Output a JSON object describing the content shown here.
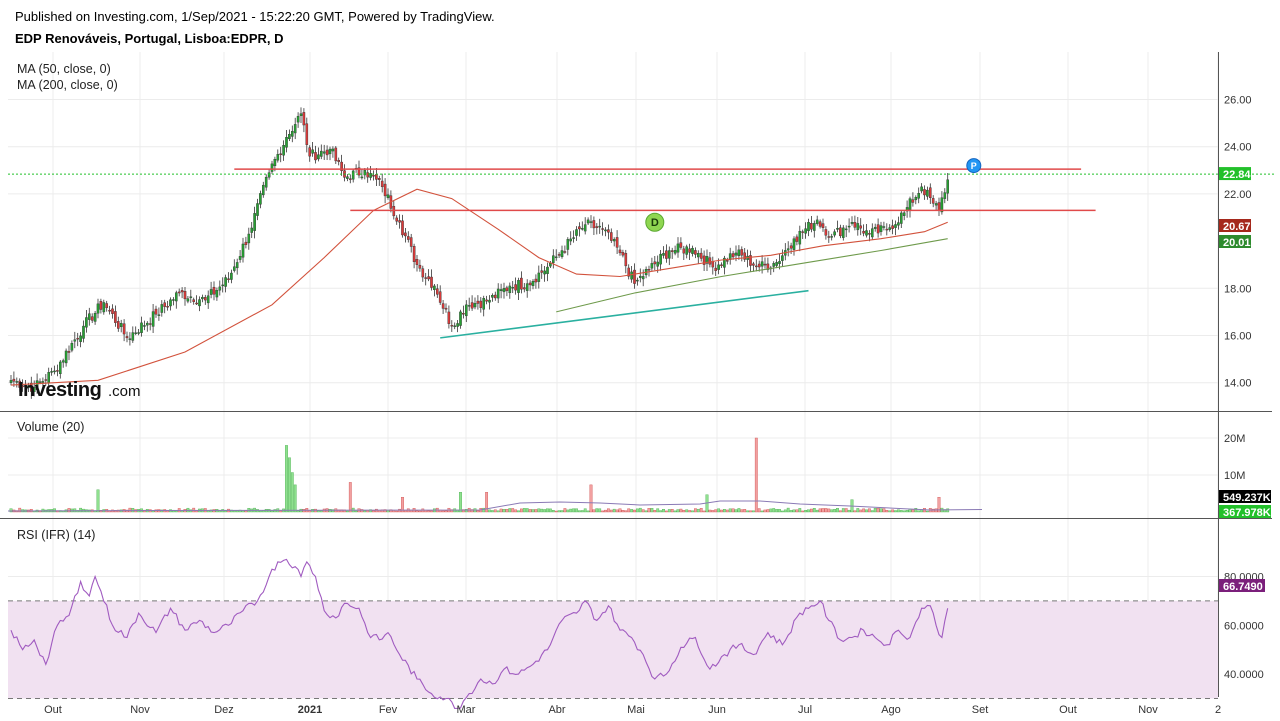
{
  "header": {
    "published": "Published on Investing.com, 1/Sep/2021 - 15:22:20 GMT, Powered by TradingView.",
    "instrument": "EDP Renováveis, Portugal, Lisboa:EDPR, D"
  },
  "watermark": "Investing.com",
  "colors": {
    "up": "#26a032",
    "down": "#d83a3a",
    "ma50": "#d2523c",
    "ma200": "#6e9a4b",
    "hline": "#e04a4a",
    "trend": "#2ab0a0",
    "rsi": "#a05bc0",
    "rsi_band": "#f1e1f1",
    "last_price": "#22c02a",
    "ma50_tag": "#a5281c",
    "ma200_tag": "#2e8b2e",
    "vol_tag1": "#000000",
    "vol_tag2": "#22c02a",
    "rsi_tag": "#7b1f7b"
  },
  "chart_data": [
    {
      "type": "candlestick",
      "title": "EDP Renováveis, Portugal, Lisboa:EDPR, D",
      "indicators": [
        "MA (50, close, 0)",
        "MA (200, close, 0)"
      ],
      "x_ticks": [
        "Out",
        "Nov",
        "Dez",
        "2021",
        "Fev",
        "Mar",
        "Abr",
        "Mai",
        "Jun",
        "Jul",
        "Ago",
        "Set",
        "Out",
        "Nov",
        "2"
      ],
      "y_ticks": [
        "26.00",
        "24.00",
        "22.00",
        "18.00",
        "16.00",
        "14.00"
      ],
      "ylim": [
        13.0,
        27.0
      ],
      "anchor_closes": [
        [
          0,
          14.1
        ],
        [
          8,
          13.8
        ],
        [
          15,
          14.5
        ],
        [
          25,
          16.4
        ],
        [
          32,
          17.4
        ],
        [
          40,
          15.9
        ],
        [
          50,
          16.9
        ],
        [
          58,
          17.8
        ],
        [
          67,
          17.5
        ],
        [
          75,
          18.4
        ],
        [
          82,
          20.3
        ],
        [
          89,
          22.9
        ],
        [
          95,
          24.4
        ],
        [
          100,
          25.4
        ],
        [
          103,
          23.6
        ],
        [
          110,
          23.9
        ],
        [
          115,
          22.7
        ],
        [
          122,
          23.0
        ],
        [
          128,
          22.3
        ],
        [
          134,
          20.8
        ],
        [
          140,
          19.0
        ],
        [
          146,
          18.1
        ],
        [
          152,
          16.4
        ],
        [
          157,
          17.3
        ],
        [
          165,
          17.5
        ],
        [
          172,
          18.1
        ],
        [
          178,
          18.2
        ],
        [
          185,
          18.9
        ],
        [
          190,
          19.6
        ],
        [
          198,
          20.7
        ],
        [
          204,
          20.5
        ],
        [
          210,
          19.5
        ],
        [
          215,
          18.2
        ],
        [
          220,
          18.8
        ],
        [
          227,
          19.6
        ],
        [
          235,
          19.7
        ],
        [
          242,
          18.9
        ],
        [
          250,
          19.5
        ],
        [
          258,
          18.9
        ],
        [
          264,
          19.1
        ],
        [
          270,
          20.1
        ],
        [
          278,
          20.9
        ],
        [
          283,
          20.2
        ],
        [
          290,
          20.8
        ],
        [
          296,
          20.3
        ],
        [
          302,
          20.5
        ],
        [
          308,
          21.2
        ],
        [
          314,
          22.3
        ],
        [
          318,
          21.6
        ],
        [
          320,
          21.3
        ],
        [
          323,
          22.6
        ]
      ],
      "ma50": [
        [
          0,
          13.9
        ],
        [
          30,
          14.1
        ],
        [
          60,
          15.3
        ],
        [
          90,
          17.3
        ],
        [
          108,
          19.3
        ],
        [
          125,
          21.3
        ],
        [
          140,
          22.2
        ],
        [
          152,
          21.8
        ],
        [
          168,
          20.5
        ],
        [
          182,
          19.3
        ],
        [
          195,
          18.6
        ],
        [
          210,
          18.5
        ],
        [
          230,
          18.9
        ],
        [
          245,
          19.2
        ],
        [
          262,
          19.4
        ],
        [
          280,
          19.8
        ],
        [
          300,
          20.1
        ],
        [
          315,
          20.4
        ],
        [
          323,
          20.8
        ]
      ],
      "ma200": [
        [
          188,
          17.0
        ],
        [
          215,
          17.8
        ],
        [
          245,
          18.5
        ],
        [
          275,
          19.1
        ],
        [
          300,
          19.6
        ],
        [
          323,
          20.1
        ]
      ],
      "hlines": [
        {
          "x0": 77,
          "x1": 369,
          "y": 23.05
        },
        {
          "x0": 117,
          "x1": 374,
          "y": 21.3
        }
      ],
      "trendline": {
        "x0": 148,
        "y0": 15.9,
        "x1": 275,
        "y1": 17.9
      },
      "markers": [
        {
          "label": "D",
          "x": 222,
          "y": 20.8
        },
        {
          "label": "P",
          "x": 332,
          "y": 23.2
        }
      ],
      "last_values": {
        "price": "22.84",
        "ma50": "20.67",
        "ma200": "20.01"
      }
    },
    {
      "type": "bar",
      "title": "Volume (20)",
      "y_ticks": [
        "20M",
        "10M"
      ],
      "last_values": {
        "volume": "549.237K",
        "volume_ma": "367.978K"
      },
      "spikes": [
        [
          30,
          9
        ],
        [
          95,
          27
        ],
        [
          96,
          22
        ],
        [
          97,
          16
        ],
        [
          98,
          11
        ],
        [
          117,
          12
        ],
        [
          135,
          6
        ],
        [
          155,
          8
        ],
        [
          164,
          8
        ],
        [
          200,
          11
        ],
        [
          240,
          7
        ],
        [
          257,
          30
        ],
        [
          290,
          5
        ],
        [
          320,
          6
        ]
      ]
    },
    {
      "type": "line",
      "title": "RSI (IFR) (14)",
      "y_ticks": [
        "80.0000",
        "60.0000",
        "40.0000"
      ],
      "ylim": [
        27,
        88
      ],
      "bands": [
        30,
        70
      ],
      "last_value": "66.7490",
      "values": [
        [
          0,
          58
        ],
        [
          4,
          50
        ],
        [
          8,
          54
        ],
        [
          12,
          44
        ],
        [
          16,
          60
        ],
        [
          20,
          64
        ],
        [
          24,
          78
        ],
        [
          27,
          72
        ],
        [
          29,
          80
        ],
        [
          31,
          74
        ],
        [
          35,
          60
        ],
        [
          40,
          55
        ],
        [
          44,
          65
        ],
        [
          50,
          57
        ],
        [
          55,
          67
        ],
        [
          60,
          58
        ],
        [
          65,
          62
        ],
        [
          70,
          57
        ],
        [
          75,
          60
        ],
        [
          80,
          66
        ],
        [
          85,
          70
        ],
        [
          89,
          80
        ],
        [
          92,
          86
        ],
        [
          95,
          87
        ],
        [
          98,
          84
        ],
        [
          100,
          80
        ],
        [
          102,
          86
        ],
        [
          105,
          80
        ],
        [
          108,
          66
        ],
        [
          112,
          63
        ],
        [
          115,
          69
        ],
        [
          120,
          67
        ],
        [
          123,
          57
        ],
        [
          127,
          54
        ],
        [
          130,
          57
        ],
        [
          134,
          48
        ],
        [
          140,
          38
        ],
        [
          145,
          32
        ],
        [
          150,
          30
        ],
        [
          154,
          26
        ],
        [
          158,
          32
        ],
        [
          162,
          38
        ],
        [
          166,
          36
        ],
        [
          170,
          42
        ],
        [
          175,
          40
        ],
        [
          180,
          44
        ],
        [
          185,
          50
        ],
        [
          190,
          62
        ],
        [
          195,
          65
        ],
        [
          198,
          70
        ],
        [
          202,
          62
        ],
        [
          206,
          68
        ],
        [
          210,
          58
        ],
        [
          214,
          55
        ],
        [
          218,
          48
        ],
        [
          222,
          38
        ],
        [
          226,
          40
        ],
        [
          231,
          51
        ],
        [
          236,
          55
        ],
        [
          241,
          42
        ],
        [
          246,
          48
        ],
        [
          251,
          52
        ],
        [
          256,
          48
        ],
        [
          261,
          57
        ],
        [
          266,
          52
        ],
        [
          272,
          65
        ],
        [
          276,
          68
        ],
        [
          279,
          70
        ],
        [
          282,
          62
        ],
        [
          286,
          54
        ],
        [
          290,
          55
        ],
        [
          294,
          58
        ],
        [
          298,
          55
        ],
        [
          302,
          52
        ],
        [
          306,
          58
        ],
        [
          310,
          55
        ],
        [
          314,
          67
        ],
        [
          317,
          68
        ],
        [
          319,
          60
        ],
        [
          321,
          55
        ],
        [
          323,
          67
        ]
      ]
    }
  ]
}
